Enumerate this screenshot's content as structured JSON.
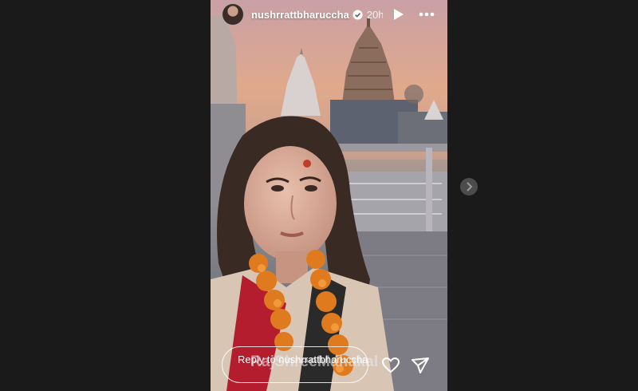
{
  "story": {
    "username": "nushrrattbharuccha",
    "time_label": "20h",
    "reply_placeholder": "Reply to nushrrattbharuccha...",
    "watermark": "RajShreeMahakal"
  },
  "icons": {
    "verified": "verified-badge-icon",
    "play": "play-icon",
    "more": "more-options-icon",
    "next": "chevron-right-icon",
    "like": "heart-icon",
    "share": "send-icon"
  },
  "colors": {
    "background": "#1a1a1a",
    "verified_badge": "#ffffff",
    "marigold": "#e07a1f"
  }
}
